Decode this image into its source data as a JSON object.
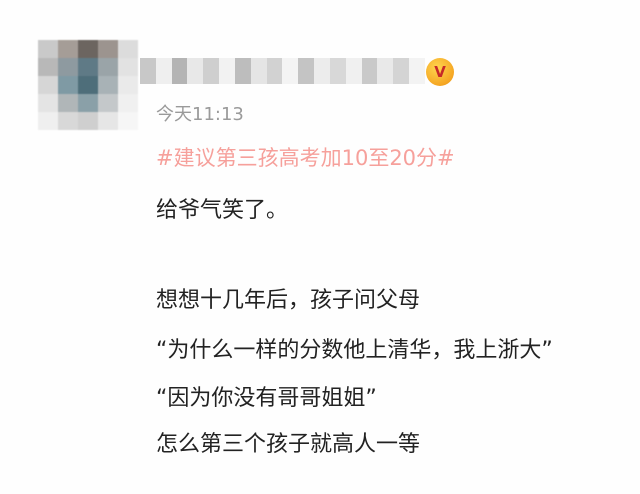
{
  "post": {
    "timestamp": "今天11:13",
    "hashtag": "#建议第三孩高考加10至20分#",
    "lines": [
      "给爷气笑了。",
      "想想十几年后，孩子问父母",
      "“为什么一样的分数他上清华，我上浙大”",
      "“因为你没有哥哥姐姐”",
      "怎么第三个孩子就高人一等"
    ]
  },
  "badge": {
    "icon": "vip-crown-icon",
    "glyph": "V"
  },
  "colors": {
    "hashtag": "#f6a09b",
    "timestamp": "#9a9a9a",
    "body_text": "#222222",
    "badge": "#f5a623"
  }
}
